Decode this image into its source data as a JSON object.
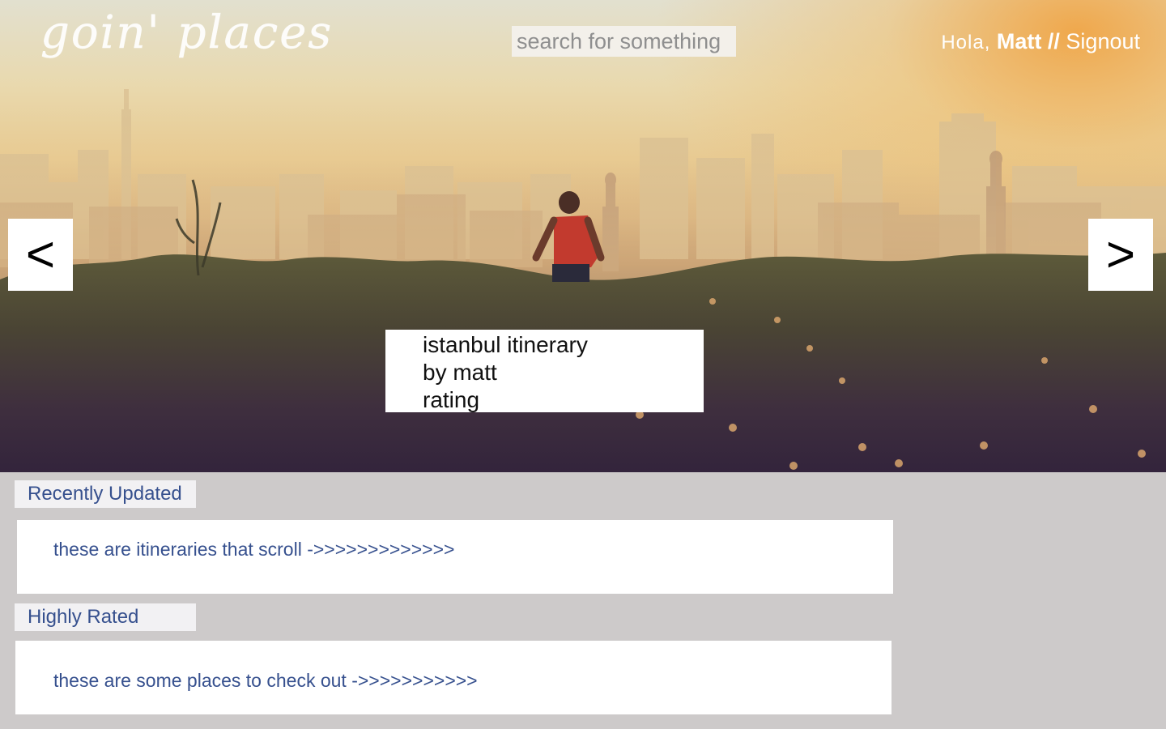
{
  "app": {
    "logo_text": "goin' places"
  },
  "header": {
    "search_placeholder": "search for something",
    "greeting": "Hola,",
    "user_name": "Matt",
    "separator": "//",
    "signout_label": "Signout"
  },
  "carousel": {
    "prev_label": "<",
    "next_label": ">",
    "featured": {
      "title": "istanbul itinerary",
      "author": "by matt",
      "rating_label": "rating"
    }
  },
  "sections": {
    "recent": {
      "label": "Recently Updated",
      "content": "these are itineraries that scroll ->>>>>>>>>>>>>"
    },
    "rated": {
      "label": "Highly Rated",
      "content": "these are some places to check out ->>>>>>>>>>>"
    }
  },
  "colors": {
    "accent_text": "#36508e",
    "lower_background": "#cdcaca",
    "label_background": "#f2f1f3"
  }
}
